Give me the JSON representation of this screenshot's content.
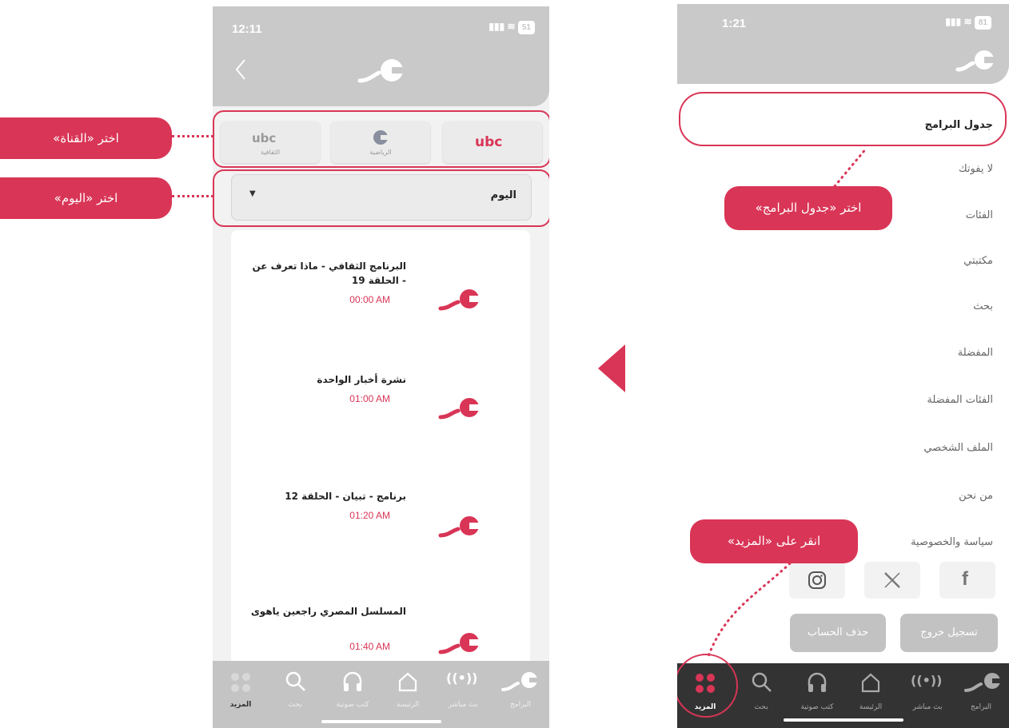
{
  "left_phone": {
    "status_time": "12:11",
    "battery": "51",
    "channels": [
      {
        "label": "الثقافية"
      },
      {
        "label": "الرياضية"
      },
      {
        "label": ""
      }
    ],
    "day_select": {
      "value": "اليوم"
    },
    "programs": [
      {
        "title": "البرنامج الثقافي - ماذا تعرف عن - الحلقة 19",
        "time": "00:00 AM"
      },
      {
        "title": "نشرة أخبار الواحدة",
        "time": "01:00 AM"
      },
      {
        "title": "برنامج - تبيان - الحلقة 12",
        "time": "01:20 AM"
      },
      {
        "title": "المسلسل المصري راجعين ياهوى",
        "time": "01:40 AM"
      }
    ],
    "nav": [
      "المزيد",
      "بحث",
      "كتب صوتية",
      "الرئيسة",
      "بث مباشر",
      "البرامج"
    ]
  },
  "right_phone": {
    "status_time": "1:21",
    "battery": "81",
    "menu": [
      "جدول البرامج",
      "لا يفوتك",
      "الفئات",
      "مكتبتي",
      "بحث",
      "المفضلة",
      "الفئات المفضلة",
      "الملف الشخصي",
      "من نحن",
      "سياسة والخصوصية"
    ],
    "buttons": {
      "logout": "تسجيل خروج",
      "delete_account": "حذف الحساب"
    },
    "nav": [
      "المزيد",
      "بحث",
      "كتب صوتية",
      "الرئيسة",
      "بث مباشر",
      "البرامج"
    ]
  },
  "callouts": {
    "choose_channel": "اختر «القناة»",
    "choose_day": "اختر «اليوم»",
    "choose_schedule": "اختر «جدول البرامج»",
    "tap_more": "انقر على «المزيد»"
  },
  "colors": {
    "accent": "#d93556",
    "header_gray": "#c9c9c9",
    "nav_dark": "#333333"
  }
}
